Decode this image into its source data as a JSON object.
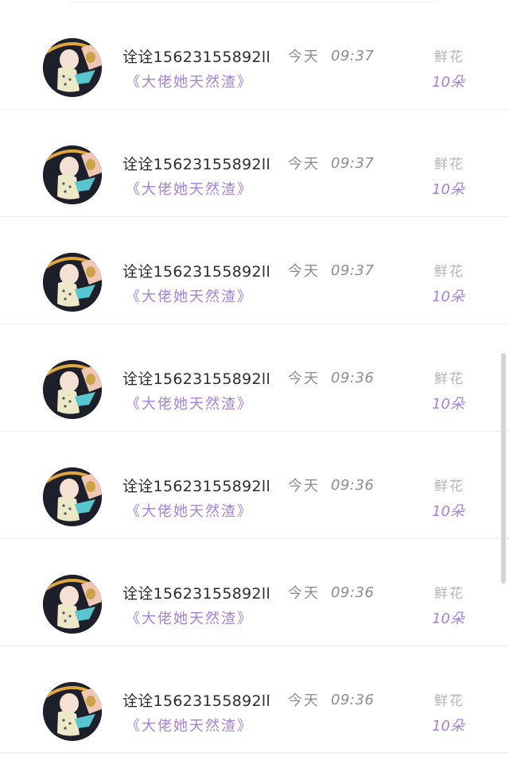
{
  "rows": [
    {
      "username": "诠诠15623155892ll",
      "day": "今天",
      "time": "09:37",
      "gift_name": "《大佬她天然渣》",
      "gift_type": "鲜花",
      "gift_count": "10朵"
    },
    {
      "username": "诠诠15623155892ll",
      "day": "今天",
      "time": "09:37",
      "gift_name": "《大佬她天然渣》",
      "gift_type": "鲜花",
      "gift_count": "10朵"
    },
    {
      "username": "诠诠15623155892ll",
      "day": "今天",
      "time": "09:37",
      "gift_name": "《大佬她天然渣》",
      "gift_type": "鲜花",
      "gift_count": "10朵"
    },
    {
      "username": "诠诠15623155892ll",
      "day": "今天",
      "time": "09:36",
      "gift_name": "《大佬她天然渣》",
      "gift_type": "鲜花",
      "gift_count": "10朵"
    },
    {
      "username": "诠诠15623155892ll",
      "day": "今天",
      "time": "09:36",
      "gift_name": "《大佬她天然渣》",
      "gift_type": "鲜花",
      "gift_count": "10朵"
    },
    {
      "username": "诠诠15623155892ll",
      "day": "今天",
      "time": "09:36",
      "gift_name": "《大佬她天然渣》",
      "gift_type": "鲜花",
      "gift_count": "10朵"
    },
    {
      "username": "诠诠15623155892ll",
      "day": "今天",
      "time": "09:36",
      "gift_name": "《大佬她天然渣》",
      "gift_type": "鲜花",
      "gift_count": "10朵"
    }
  ],
  "colors": {
    "accent": "#a681d8",
    "username": "#2d2d2d",
    "meta": "#8d8d8d",
    "gift_type": "#b5b5b5",
    "divider": "#eeeeee",
    "scrollbar": "#d4d4d4"
  },
  "icons": {
    "avatar": "baby-photo-avatar"
  }
}
